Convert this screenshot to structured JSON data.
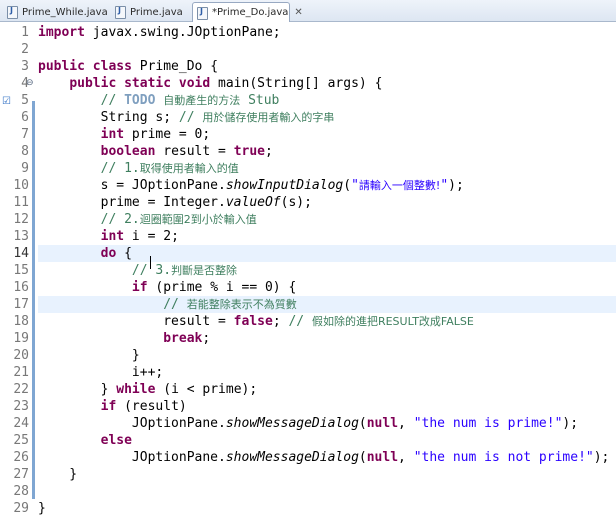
{
  "tabs": [
    {
      "label": "Prime_While.java",
      "active": false
    },
    {
      "label": "Prime.java",
      "active": false
    },
    {
      "label": "*Prime_Do.java",
      "active": true
    }
  ],
  "editor": {
    "current_line": 14,
    "line_numbers": [
      "1",
      "2",
      "3",
      "4",
      "5",
      "6",
      "7",
      "8",
      "9",
      "10",
      "11",
      "12",
      "13",
      "14",
      "15",
      "16",
      "17",
      "18",
      "19",
      "20",
      "21",
      "22",
      "23",
      "24",
      "25",
      "26",
      "27",
      "28",
      "29"
    ],
    "fold_marker": "⊖",
    "lines": [
      [
        [
          "kw",
          "import"
        ],
        [
          "t",
          " javax.swing.JOptionPane;"
        ]
      ],
      [],
      [
        [
          "kw",
          "public class"
        ],
        [
          "t",
          " Prime_Do {"
        ]
      ],
      [
        [
          "t",
          "    "
        ],
        [
          "kw",
          "public static void"
        ],
        [
          "t",
          " main(String[] args) {"
        ]
      ],
      [
        [
          "t",
          "        "
        ],
        [
          "cm",
          "// "
        ],
        [
          "todo",
          "TODO"
        ],
        [
          "cm",
          " "
        ],
        [
          "cmcjk",
          "自動產生的方法"
        ],
        [
          "cm",
          " Stub"
        ]
      ],
      [
        [
          "t",
          "        String s; "
        ],
        [
          "cm",
          "// "
        ],
        [
          "cmcjk",
          "用於儲存使用者輸入的字串"
        ]
      ],
      [
        [
          "t",
          "        "
        ],
        [
          "kw",
          "int"
        ],
        [
          "t",
          " prime = 0;"
        ]
      ],
      [
        [
          "t",
          "        "
        ],
        [
          "kw",
          "boolean"
        ],
        [
          "t",
          " result = "
        ],
        [
          "kw",
          "true"
        ],
        [
          "t",
          ";"
        ]
      ],
      [
        [
          "t",
          "        "
        ],
        [
          "cm",
          "// 1."
        ],
        [
          "cmcjk",
          "取得使用者輸入的值"
        ]
      ],
      [
        [
          "t",
          "        s = JOptionPane."
        ],
        [
          "it",
          "showInputDialog"
        ],
        [
          "t",
          "("
        ],
        [
          "str",
          "\""
        ],
        [
          "strcjk",
          "請輸入一個整數!"
        ],
        [
          "str",
          "\""
        ],
        [
          "t",
          ");"
        ]
      ],
      [
        [
          "t",
          "        prime = Integer."
        ],
        [
          "it",
          "valueOf"
        ],
        [
          "t",
          "(s);"
        ]
      ],
      [
        [
          "t",
          "        "
        ],
        [
          "cm",
          "// 2."
        ],
        [
          "cmcjk",
          "迴圈範圍2到小於輸入值"
        ]
      ],
      [
        [
          "t",
          "        "
        ],
        [
          "kw",
          "int"
        ],
        [
          "t",
          " i = 2;"
        ]
      ],
      [
        [
          "t",
          "        "
        ],
        [
          "kw",
          "do"
        ],
        [
          "t",
          " {"
        ]
      ],
      [
        [
          "t",
          "            "
        ],
        [
          "cm",
          "// 3."
        ],
        [
          "cmcjk",
          "判斷是否整除"
        ]
      ],
      [
        [
          "t",
          "            "
        ],
        [
          "kw",
          "if"
        ],
        [
          "t",
          " (prime % i == 0) {"
        ]
      ],
      [
        [
          "t",
          "                "
        ],
        [
          "cm",
          "// "
        ],
        [
          "cmcjk",
          "若能整除表示不為質數"
        ]
      ],
      [
        [
          "t",
          "                result = "
        ],
        [
          "kw",
          "false"
        ],
        [
          "t",
          "; "
        ],
        [
          "cm",
          "// "
        ],
        [
          "cmcjk",
          "假如除的進把RESULT改成FALSE"
        ]
      ],
      [
        [
          "t",
          "                "
        ],
        [
          "kw",
          "break"
        ],
        [
          "t",
          ";"
        ]
      ],
      [
        [
          "t",
          "            }"
        ]
      ],
      [
        [
          "t",
          "            i++;"
        ]
      ],
      [
        [
          "t",
          "        } "
        ],
        [
          "kw",
          "while"
        ],
        [
          "t",
          " (i < prime);"
        ]
      ],
      [
        [
          "t",
          "        "
        ],
        [
          "kw",
          "if"
        ],
        [
          "t",
          " (result)"
        ]
      ],
      [
        [
          "t",
          "            JOptionPane."
        ],
        [
          "it",
          "showMessageDialog"
        ],
        [
          "t",
          "("
        ],
        [
          "kw",
          "null"
        ],
        [
          "t",
          ", "
        ],
        [
          "str",
          "\"the num is prime!\""
        ],
        [
          "t",
          ");"
        ]
      ],
      [
        [
          "t",
          "        "
        ],
        [
          "kw",
          "else"
        ]
      ],
      [
        [
          "t",
          "            JOptionPane."
        ],
        [
          "it",
          "showMessageDialog"
        ],
        [
          "t",
          "("
        ],
        [
          "kw",
          "null"
        ],
        [
          "t",
          ", "
        ],
        [
          "str",
          "\"the num is not prime!\""
        ],
        [
          "t",
          ");"
        ]
      ],
      [
        [
          "t",
          "    }"
        ]
      ],
      [],
      [
        [
          "t",
          "}"
        ]
      ]
    ]
  }
}
